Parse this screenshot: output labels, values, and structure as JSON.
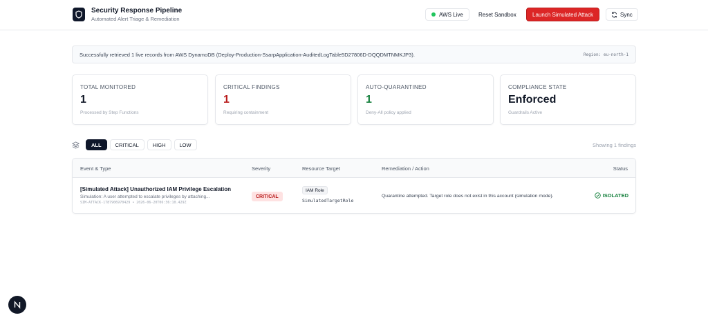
{
  "header": {
    "title": "Security Response Pipeline",
    "subtitle": "Automated Alert Triage & Remediation",
    "live_label": "AWS Live",
    "reset_label": "Reset Sandbox",
    "launch_label": "Launch Simulated Attack",
    "sync_label": "Sync"
  },
  "banner": {
    "message": "Successfully retrieved 1 live records from AWS DynamoDB (Deploy-Production-SsarpApplication-AuditedLogTable5D27806D-DQQDMTNMKJP3).",
    "region": "Region: eu-north-1"
  },
  "cards": [
    {
      "label": "TOTAL MONITORED",
      "value": "1",
      "note": "Processed by Step Functions",
      "color": "#111827"
    },
    {
      "label": "CRITICAL FINDINGS",
      "value": "1",
      "note": "Requiring containment",
      "color": "#b91c1c"
    },
    {
      "label": "AUTO-QUARANTINED",
      "value": "1",
      "note": "Deny-All policy applied",
      "color": "#15803d"
    },
    {
      "label": "COMPLIANCE STATE",
      "value": "Enforced",
      "note": "Guardrails Active",
      "color": "#111827"
    }
  ],
  "filters": {
    "items": [
      "ALL",
      "CRITICAL",
      "HIGH",
      "LOW"
    ],
    "active": "ALL",
    "showing": "Showing 1 findings"
  },
  "table": {
    "columns": [
      "Event & Type",
      "Severity",
      "Resource Target",
      "Remediation / Action",
      "Status"
    ],
    "rows": [
      {
        "title": "[Simulated Attack] Unauthorized IAM Privilege Escalation",
        "description": "Simulation: A user attempted to escalate privileges by attaching...",
        "id_line": "SIM-ATTACK-1787906970429 • 2026-06-20T06:36:10.429Z",
        "severity": "CRITICAL",
        "resource_type": "IAM Role",
        "resource_name": "SimulatedTargetRole",
        "remediation": "Quarantine attempted. Target role does not exist in this account (simulation mode).",
        "status": "ISOLATED"
      }
    ]
  },
  "icons": {
    "logo": "shield-icon",
    "live": "status-dot-icon",
    "sync": "refresh-icon",
    "filter": "layers-icon",
    "status": "check-circle-icon",
    "framework_badge": "n-logo-icon"
  },
  "colors": {
    "accent_red": "#dc2626",
    "dark": "#0f172a",
    "success": "#15803d",
    "live_dot": "#22c55e"
  }
}
